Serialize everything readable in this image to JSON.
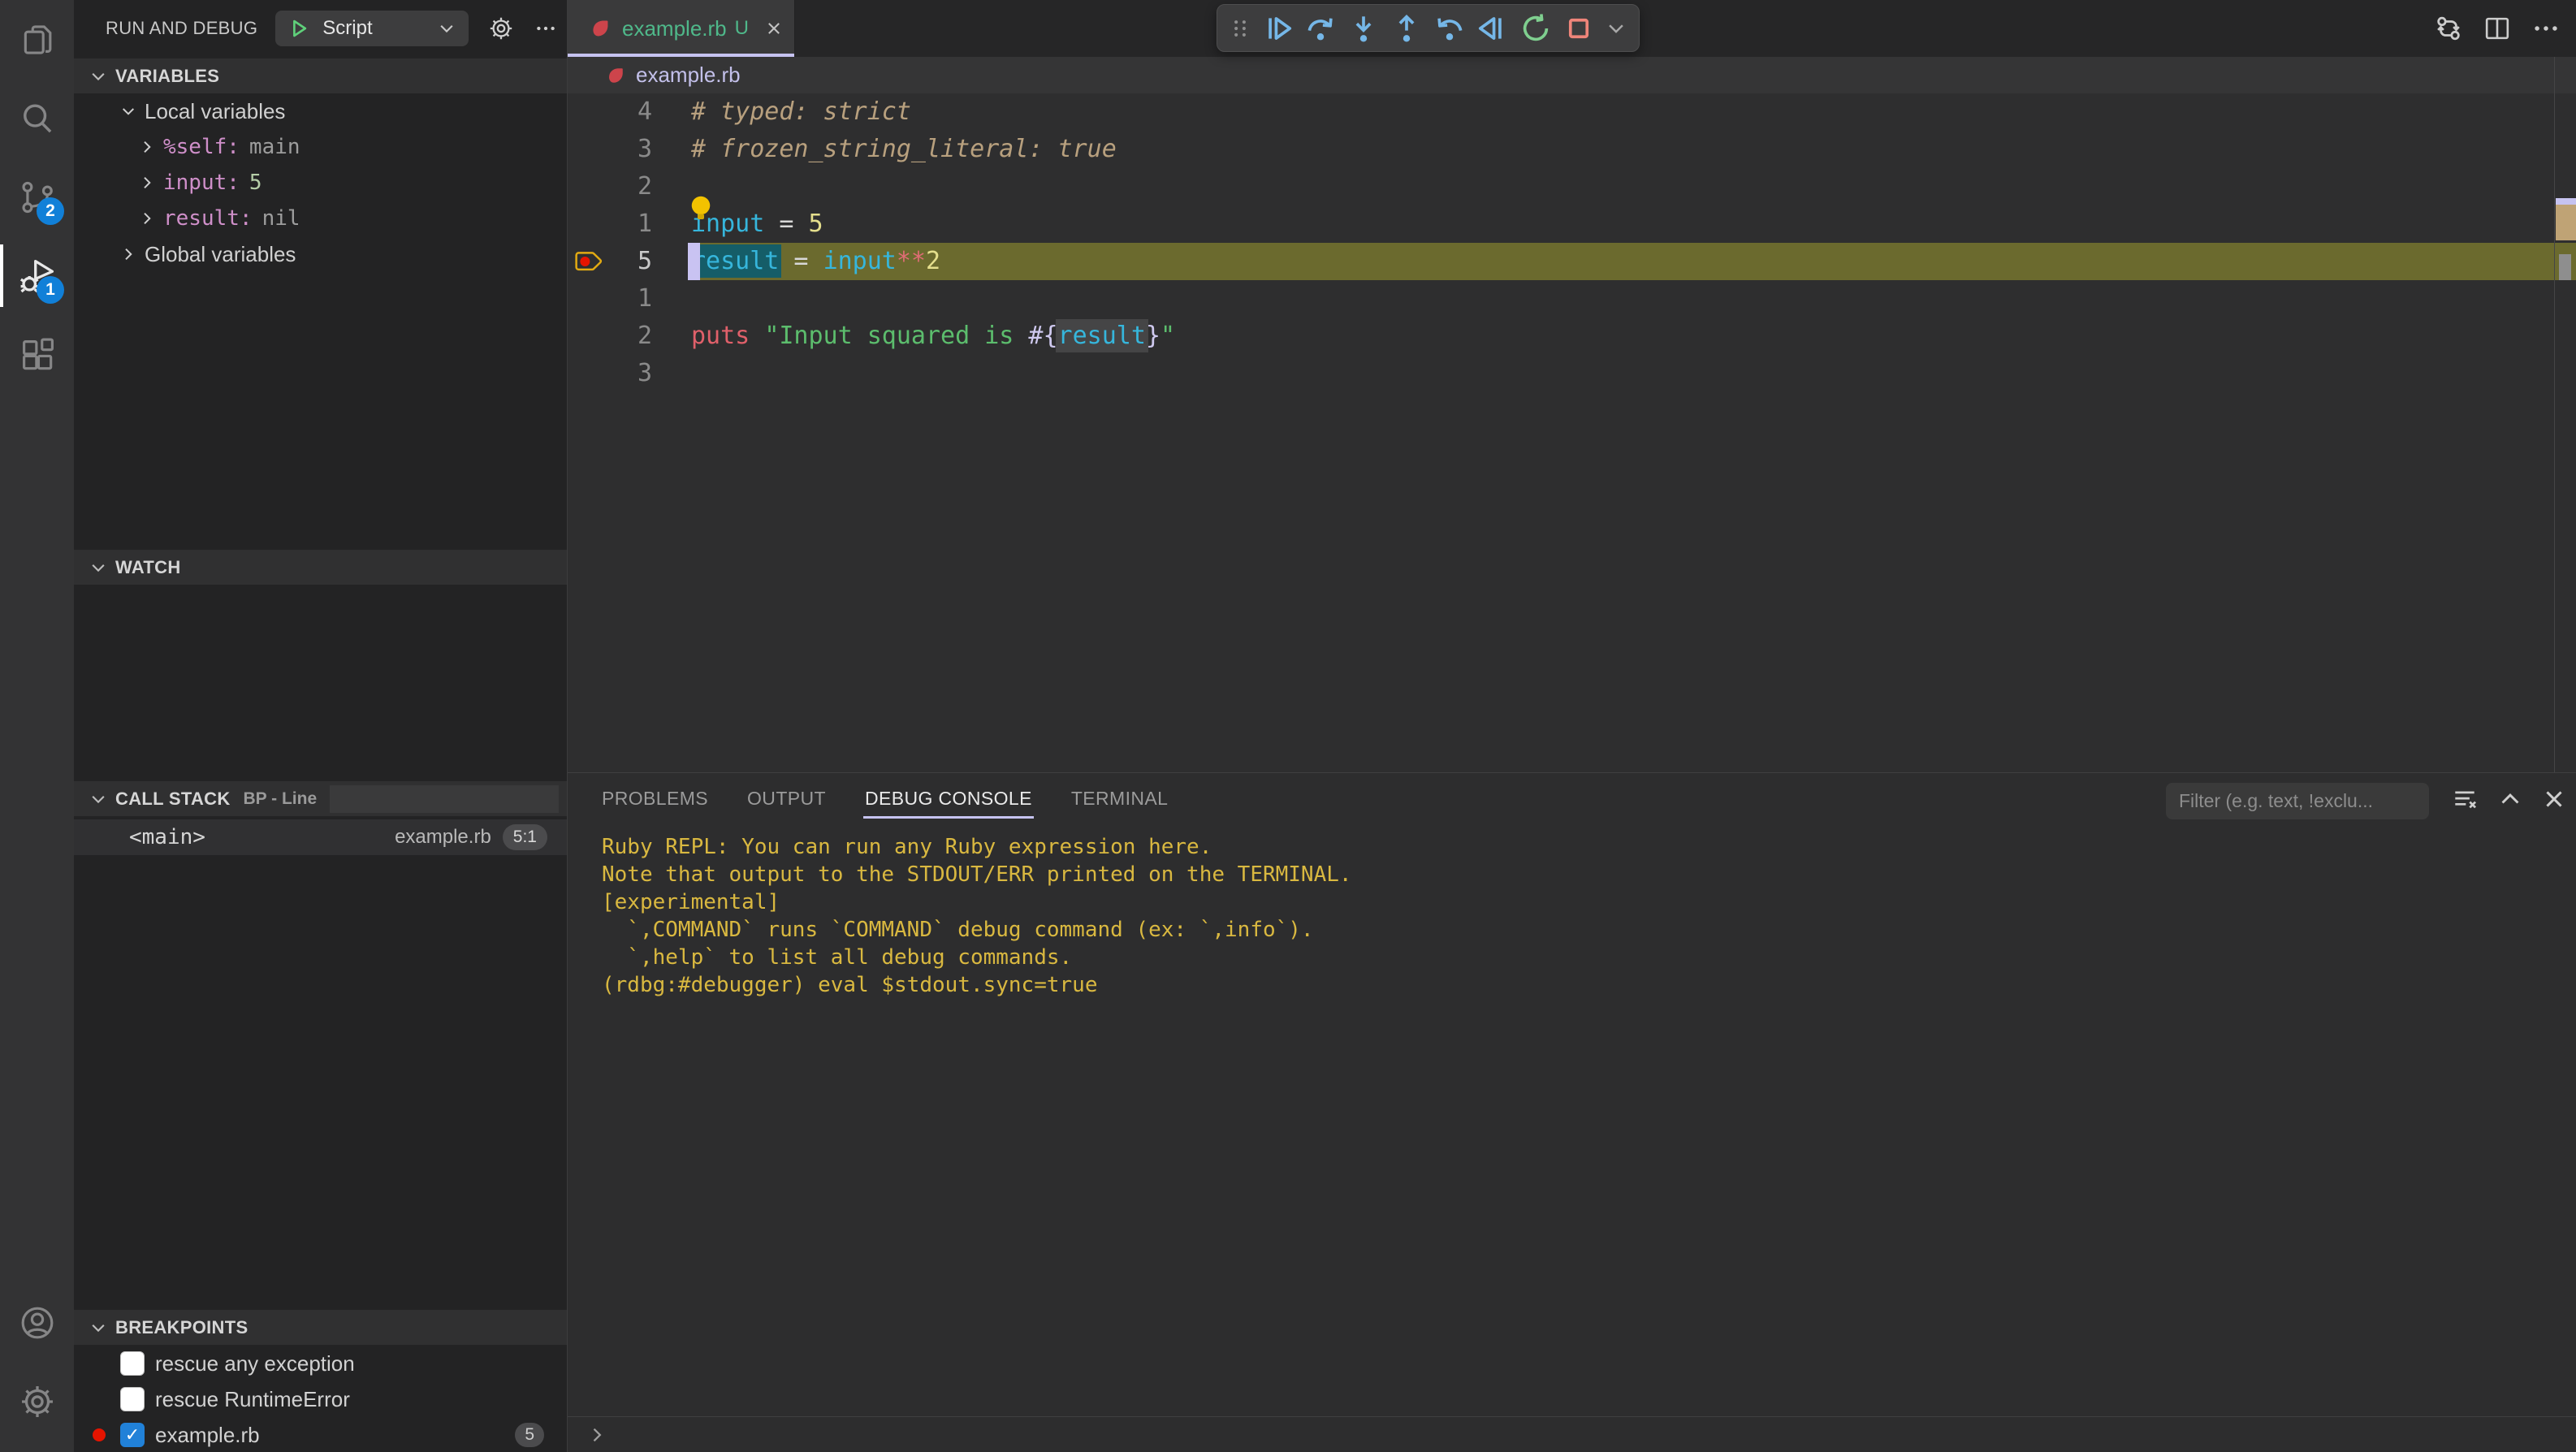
{
  "colors": {
    "accent_lavender": "#c6c3f0",
    "badge_blue": "#1180d8",
    "current_line_olive": "#6b6a2e",
    "breakpoint_red": "#e51400",
    "breakpoint_outline_yellow": "#e2aa12",
    "modified_file_green": "#4fb88a",
    "console_gold": "#d9b840",
    "ruby_red": "#cd444b",
    "variable_pink": "#cf8fc9",
    "variable_cyan": "#36b6dc",
    "word_highlight_teal": "#155d68"
  },
  "activity_bar": {
    "items": [
      {
        "name": "explorer",
        "icon": "files-icon",
        "badge": "",
        "active": false
      },
      {
        "name": "search",
        "icon": "search-icon",
        "badge": "",
        "active": false
      },
      {
        "name": "source-control",
        "icon": "source-control-icon",
        "badge": "2",
        "active": false
      },
      {
        "name": "run-and-debug",
        "icon": "debug-icon",
        "badge": "1",
        "active": true
      },
      {
        "name": "extensions",
        "icon": "extensions-icon",
        "badge": "",
        "active": false
      }
    ],
    "bottom_items": [
      {
        "name": "accounts",
        "icon": "account-icon"
      },
      {
        "name": "settings",
        "icon": "gear-icon"
      }
    ]
  },
  "sidebar": {
    "title": "RUN AND DEBUG",
    "launch_config_label": "Script",
    "variables_header": "VARIABLES",
    "watch_header": "WATCH",
    "call_stack_header": "CALL STACK",
    "call_stack_subtitle": "BP - Line",
    "breakpoints_header": "BREAKPOINTS",
    "variables_rows": [
      {
        "kind": "group",
        "label": "Local variables",
        "chevron": "down"
      },
      {
        "kind": "var",
        "name": "%self:",
        "value": "main",
        "value_type": "plain"
      },
      {
        "kind": "var",
        "name": "input:",
        "value": "5",
        "value_type": "number"
      },
      {
        "kind": "var",
        "name": "result:",
        "value": "nil",
        "value_type": "plain"
      },
      {
        "kind": "group",
        "label": "Global variables",
        "chevron": "right"
      }
    ],
    "call_stack_frames": [
      {
        "name": "<main>",
        "file": "example.rb",
        "position": "5:1"
      }
    ],
    "breakpoints": [
      {
        "label": "rescue any exception",
        "checked": false,
        "dot": false,
        "badge": ""
      },
      {
        "label": "rescue RuntimeError",
        "checked": false,
        "dot": false,
        "badge": ""
      },
      {
        "label": "example.rb",
        "checked": true,
        "dot": true,
        "badge": "5"
      }
    ]
  },
  "editor": {
    "tab_label": "example.rb",
    "tab_modified_indicator": "U",
    "breadcrumb": "example.rb",
    "code_lines": [
      {
        "n": "4",
        "segs": [
          {
            "t": "# typed: strict",
            "s": "comment"
          }
        ]
      },
      {
        "n": "3",
        "segs": [
          {
            "t": "# frozen_string_literal: true",
            "s": "comment"
          }
        ]
      },
      {
        "n": "2",
        "segs": []
      },
      {
        "n": "1",
        "lightbulb": true,
        "segs": [
          {
            "t": "input",
            "s": "variable"
          },
          {
            "t": " = ",
            "s": "operator"
          },
          {
            "t": "5",
            "s": "number"
          }
        ]
      },
      {
        "n": "5",
        "current": true,
        "breakpoint": true,
        "cursor": true,
        "segs": [
          {
            "t": "result",
            "s": "variable hlwrite"
          },
          {
            "t": " = ",
            "s": "operator"
          },
          {
            "t": "input",
            "s": "variable"
          },
          {
            "t": "**",
            "s": "salmon"
          },
          {
            "t": "2",
            "s": "number"
          }
        ]
      },
      {
        "n": "1",
        "segs": []
      },
      {
        "n": "2",
        "segs": [
          {
            "t": "puts",
            "s": "keyword"
          },
          {
            "t": " ",
            "s": "plain"
          },
          {
            "t": "\"Input squared is ",
            "s": "string"
          },
          {
            "t": "#{",
            "s": "interp"
          },
          {
            "t": "result",
            "s": "variable hlread"
          },
          {
            "t": "}",
            "s": "interp"
          },
          {
            "t": "\"",
            "s": "string"
          }
        ]
      },
      {
        "n": "3",
        "segs": []
      }
    ]
  },
  "debug_toolbar": {
    "buttons": [
      {
        "name": "drag-handle",
        "color": "#8f8f8f",
        "narrow": true
      },
      {
        "name": "continue",
        "color": "#75b7e8"
      },
      {
        "name": "step-over",
        "color": "#75b7e8"
      },
      {
        "name": "step-into",
        "color": "#75b7e8"
      },
      {
        "name": "step-out",
        "color": "#75b7e8"
      },
      {
        "name": "step-back",
        "color": "#75b7e8"
      },
      {
        "name": "reverse-continue",
        "color": "#75b7e8"
      },
      {
        "name": "restart",
        "color": "#7fcf8f"
      },
      {
        "name": "stop",
        "color": "#ef857a"
      },
      {
        "name": "dropdown-chevron",
        "color": "#a8a8a8",
        "narrow": true
      }
    ]
  },
  "panel": {
    "tabs": [
      {
        "label": "PROBLEMS",
        "active": false
      },
      {
        "label": "OUTPUT",
        "active": false
      },
      {
        "label": "DEBUG CONSOLE",
        "active": true
      },
      {
        "label": "TERMINAL",
        "active": false
      }
    ],
    "filter_placeholder": "Filter (e.g. text, !exclu...",
    "console_lines": [
      "Ruby REPL: You can run any Ruby expression here.",
      "Note that output to the STDOUT/ERR printed on the TERMINAL.",
      "[experimental]",
      "  `,COMMAND` runs `COMMAND` debug command (ex: `,info`).",
      "  `,help` to list all debug commands.",
      "(rdbg:#debugger) eval $stdout.sync=true"
    ]
  }
}
